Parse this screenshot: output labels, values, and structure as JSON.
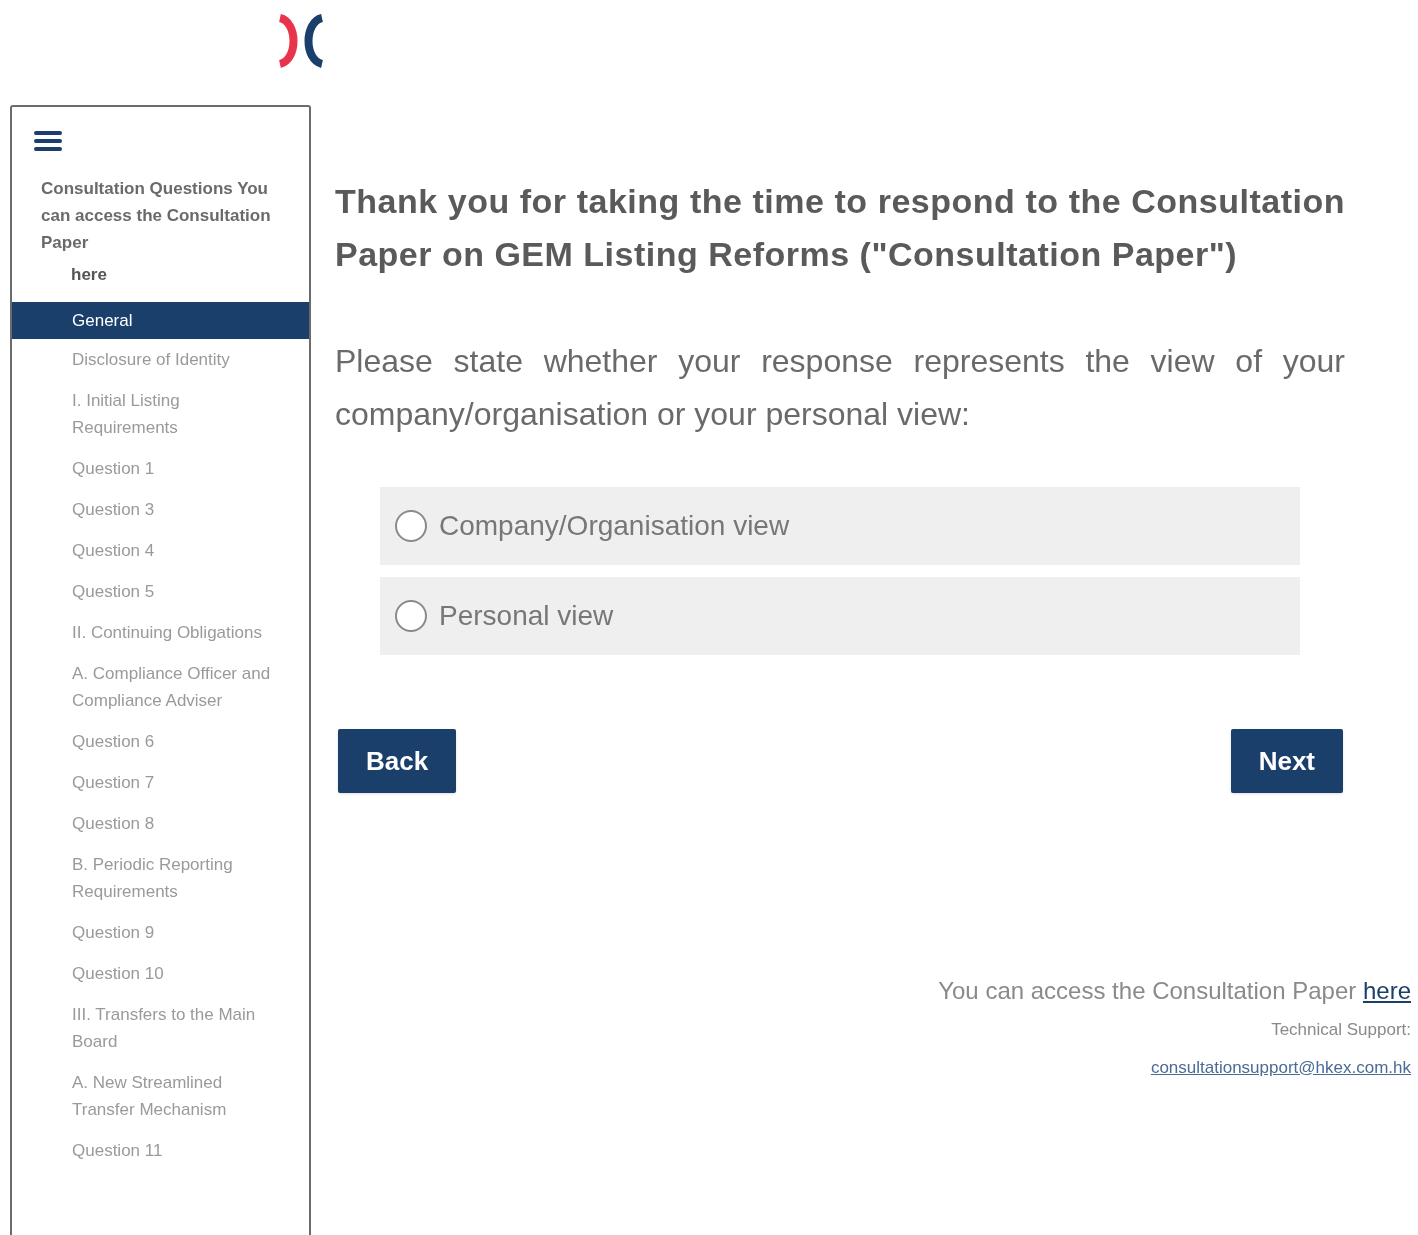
{
  "sidebar": {
    "header": "Consultation Questions You can access the Consultation Paper",
    "header_link": "here",
    "items": [
      {
        "label": "General",
        "selected": true
      },
      {
        "label": "Disclosure of Identity",
        "selected": false
      },
      {
        "label": "I. Initial Listing Requirements",
        "selected": false
      },
      {
        "label": "Question 1",
        "selected": false
      },
      {
        "label": "Question 3",
        "selected": false
      },
      {
        "label": "Question 4",
        "selected": false
      },
      {
        "label": "Question 5",
        "selected": false
      },
      {
        "label": "II. Continuing Obligations",
        "selected": false
      },
      {
        "label": "A. Compliance Officer and Compliance Adviser",
        "selected": false
      },
      {
        "label": "Question 6",
        "selected": false
      },
      {
        "label": "Question 7",
        "selected": false
      },
      {
        "label": "Question 8",
        "selected": false
      },
      {
        "label": "B. Periodic Reporting Requirements",
        "selected": false
      },
      {
        "label": "Question 9",
        "selected": false
      },
      {
        "label": "Question 10",
        "selected": false
      },
      {
        "label": "III. Transfers to the Main Board",
        "selected": false
      },
      {
        "label": "A. New Streamlined Transfer Mechanism",
        "selected": false
      },
      {
        "label": "Question 11",
        "selected": false
      }
    ]
  },
  "main": {
    "heading": "Thank you for taking the time to respond to the Consultation Paper on GEM Listing Reforms (\"Consultation Paper\")",
    "question": "Please state whether your response represents the view of your company/organisation or your personal view:",
    "options": [
      {
        "label": "Company/Organisation view",
        "selected": false
      },
      {
        "label": "Personal view",
        "selected": false
      }
    ],
    "buttons": [
      "Back",
      "Next"
    ]
  },
  "footer": {
    "access_text": "You can access the Consultation Paper",
    "access_link": "here",
    "support_label": "Technical Support:",
    "support_email": "consultationsupport@hkex.com.hk"
  }
}
